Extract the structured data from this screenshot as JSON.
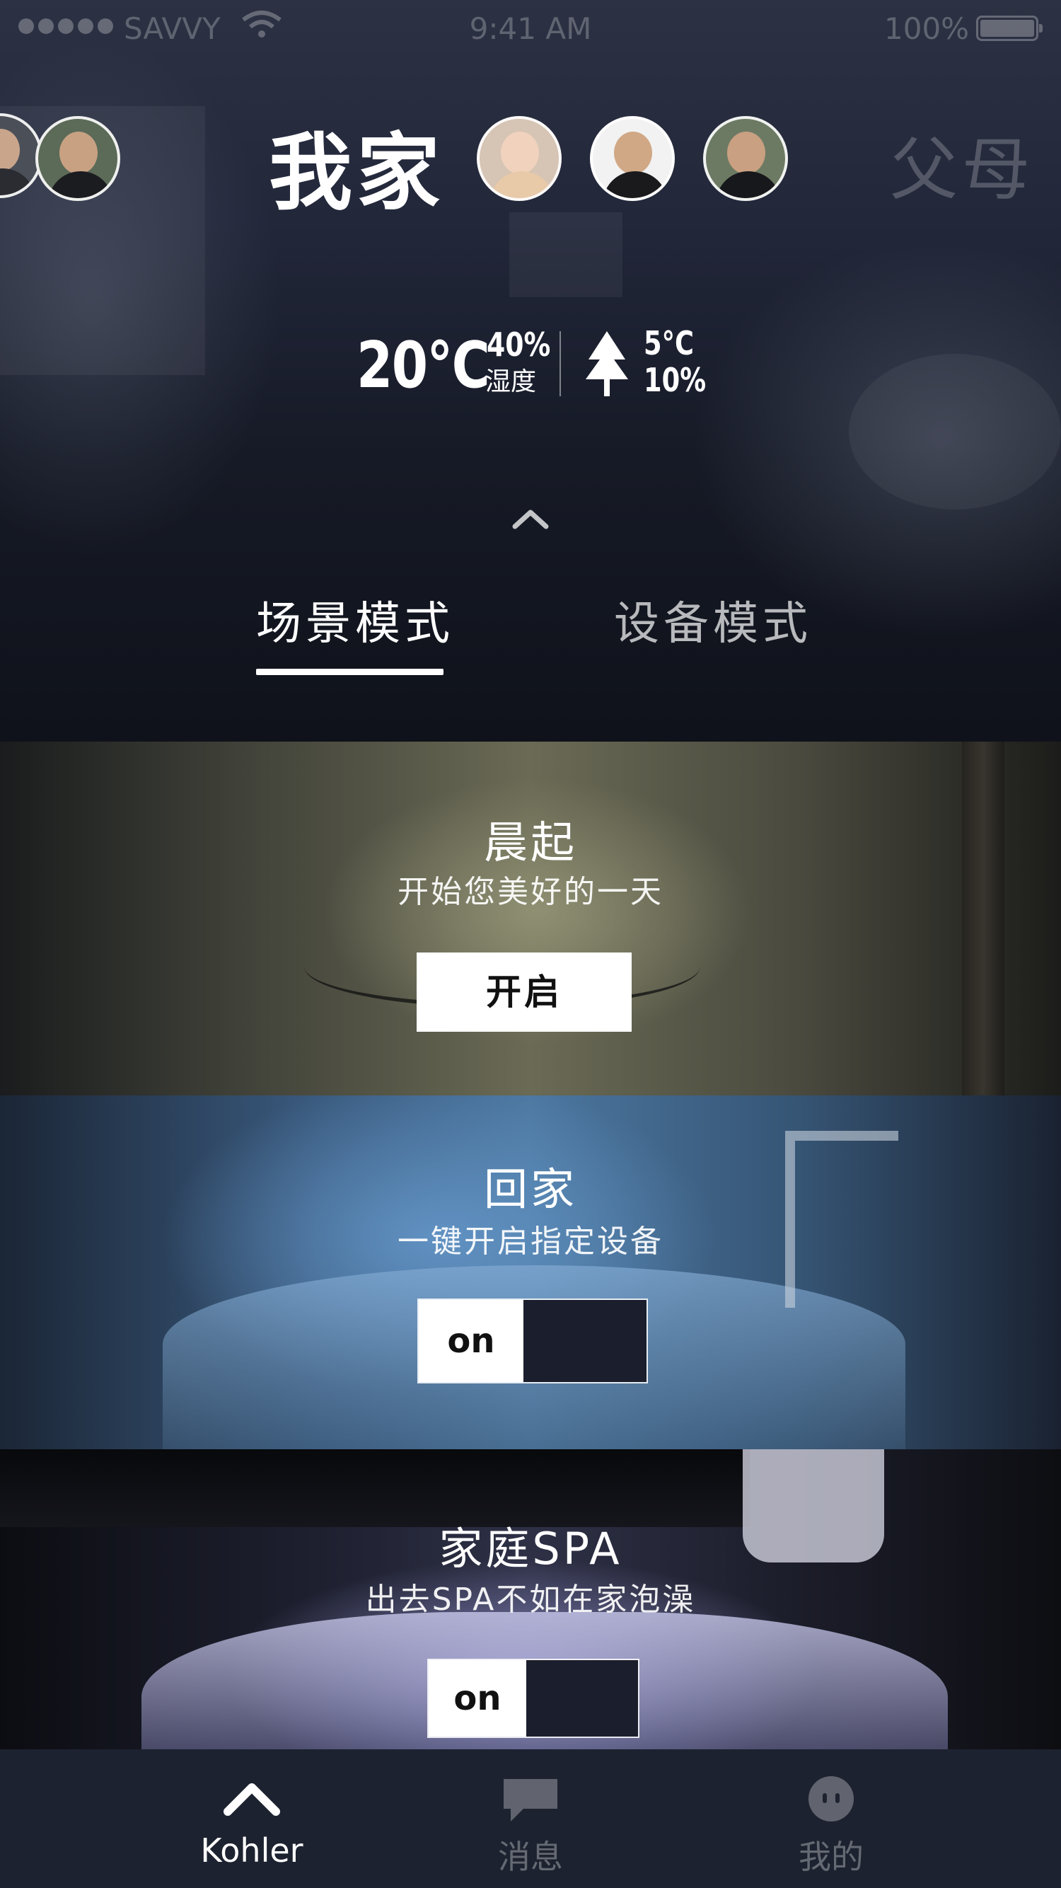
{
  "status_bar": {
    "carrier": "SAVVY",
    "time": "9:41 AM",
    "battery": "100%"
  },
  "family": {
    "current": "我家",
    "next": "父母",
    "members": [
      "avatar-woman",
      "avatar-man-suit",
      "avatar-man-camera"
    ]
  },
  "weather": {
    "indoor_temp": "20°C",
    "humidity": "40%",
    "humidity_label": "湿度",
    "outdoor_temp": "5°C",
    "outdoor_pct": "10%",
    "outdoor_icon": "tree-icon"
  },
  "tabs": {
    "scene": "场景模式",
    "device": "设备模式",
    "active": "scene"
  },
  "scenes": [
    {
      "title": "晨起",
      "subtitle": "开始您美好的一天",
      "action": "开启"
    },
    {
      "title": "回家",
      "subtitle": "一键开启指定设备",
      "toggle": "on"
    },
    {
      "title": "家庭SPA",
      "subtitle": "出去SPA不如在家泡澡",
      "toggle": "on"
    }
  ],
  "nav": {
    "items": [
      {
        "label": "Kohler",
        "icon": "home-chevron-icon",
        "active": true
      },
      {
        "label": "消息",
        "icon": "message-icon",
        "active": false
      },
      {
        "label": "我的",
        "icon": "profile-icon",
        "active": false
      }
    ]
  },
  "colors": {
    "accent": "#ffffff",
    "tabbar_bg": "#1d2230",
    "toggle_off": "#1b1f2d"
  }
}
